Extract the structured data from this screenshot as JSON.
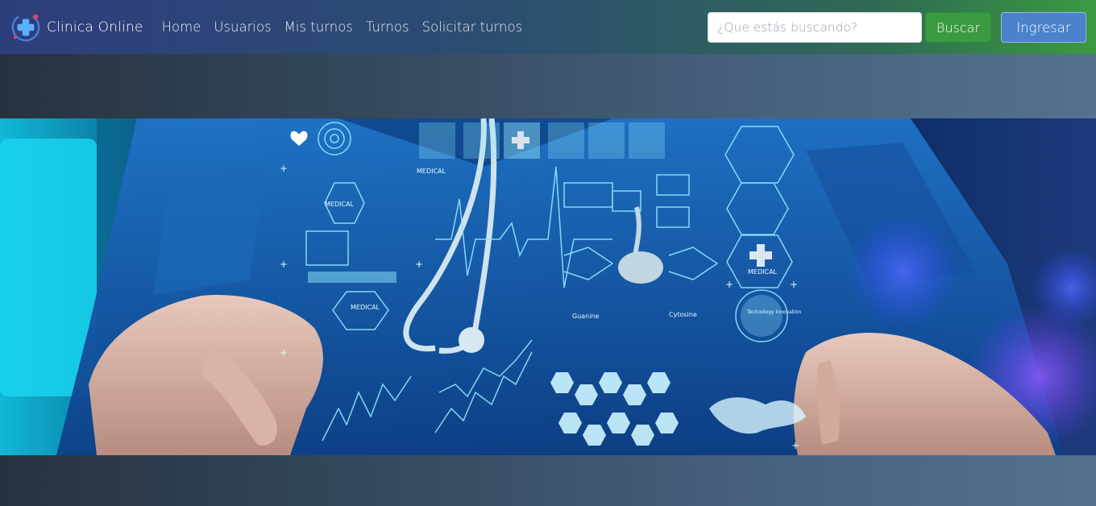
{
  "brand": {
    "name": "Clinica Online",
    "logo_icon": "medical-cross-icon"
  },
  "nav": {
    "items": [
      {
        "label": "Home"
      },
      {
        "label": "Usuarios"
      },
      {
        "label": "Mis turnos"
      },
      {
        "label": "Turnos"
      },
      {
        "label": "Solicitar turnos"
      }
    ]
  },
  "search": {
    "placeholder": "¿Que estás buscando?",
    "value": "",
    "button_label": "Buscar"
  },
  "login": {
    "label": "Ingresar"
  },
  "hero": {
    "labels": {
      "medical_1": "MEDICAL",
      "medical_2": "MEDICAL",
      "medical_3": "MEDICAL",
      "medical_4": "MEDICAL",
      "guanine": "Guanine",
      "cytosine": "Cytosine",
      "technology": "Technology Innovation"
    }
  },
  "colors": {
    "navbar_start": "#2d3e7c",
    "navbar_end": "#3a9a41",
    "search_button": "#3a9a41",
    "login_button": "#4a82cc",
    "hologram": "#8fe8ff"
  }
}
